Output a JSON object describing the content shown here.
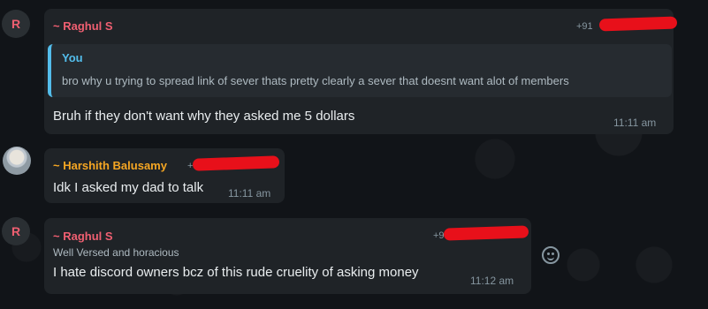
{
  "messages": [
    {
      "avatar_letter": "R",
      "sender": "~ Raghul S",
      "sender_color": "#ef5f71",
      "phone": "+91",
      "quote": {
        "author": "You",
        "text": "bro why u trying to spread link of sever thats pretty clearly a sever that doesnt want alot of members"
      },
      "text": "Bruh if they don't want why they asked me 5 dollars",
      "time": "11:11 am"
    },
    {
      "sender": "~ Harshith Balusamy",
      "sender_color": "#f5a623",
      "phone": "+91",
      "text": "Idk I asked my dad to talk",
      "time": "11:11 am"
    },
    {
      "avatar_letter": "R",
      "sender": "~ Raghul S",
      "sender_color": "#ef5f71",
      "phone": "+9",
      "about": "Well Versed and horacious",
      "text": "I hate discord owners bcz of this rude cruelity of asking money",
      "time": "11:12 am"
    }
  ],
  "icons": {
    "reaction": "emoji-smile-icon"
  }
}
